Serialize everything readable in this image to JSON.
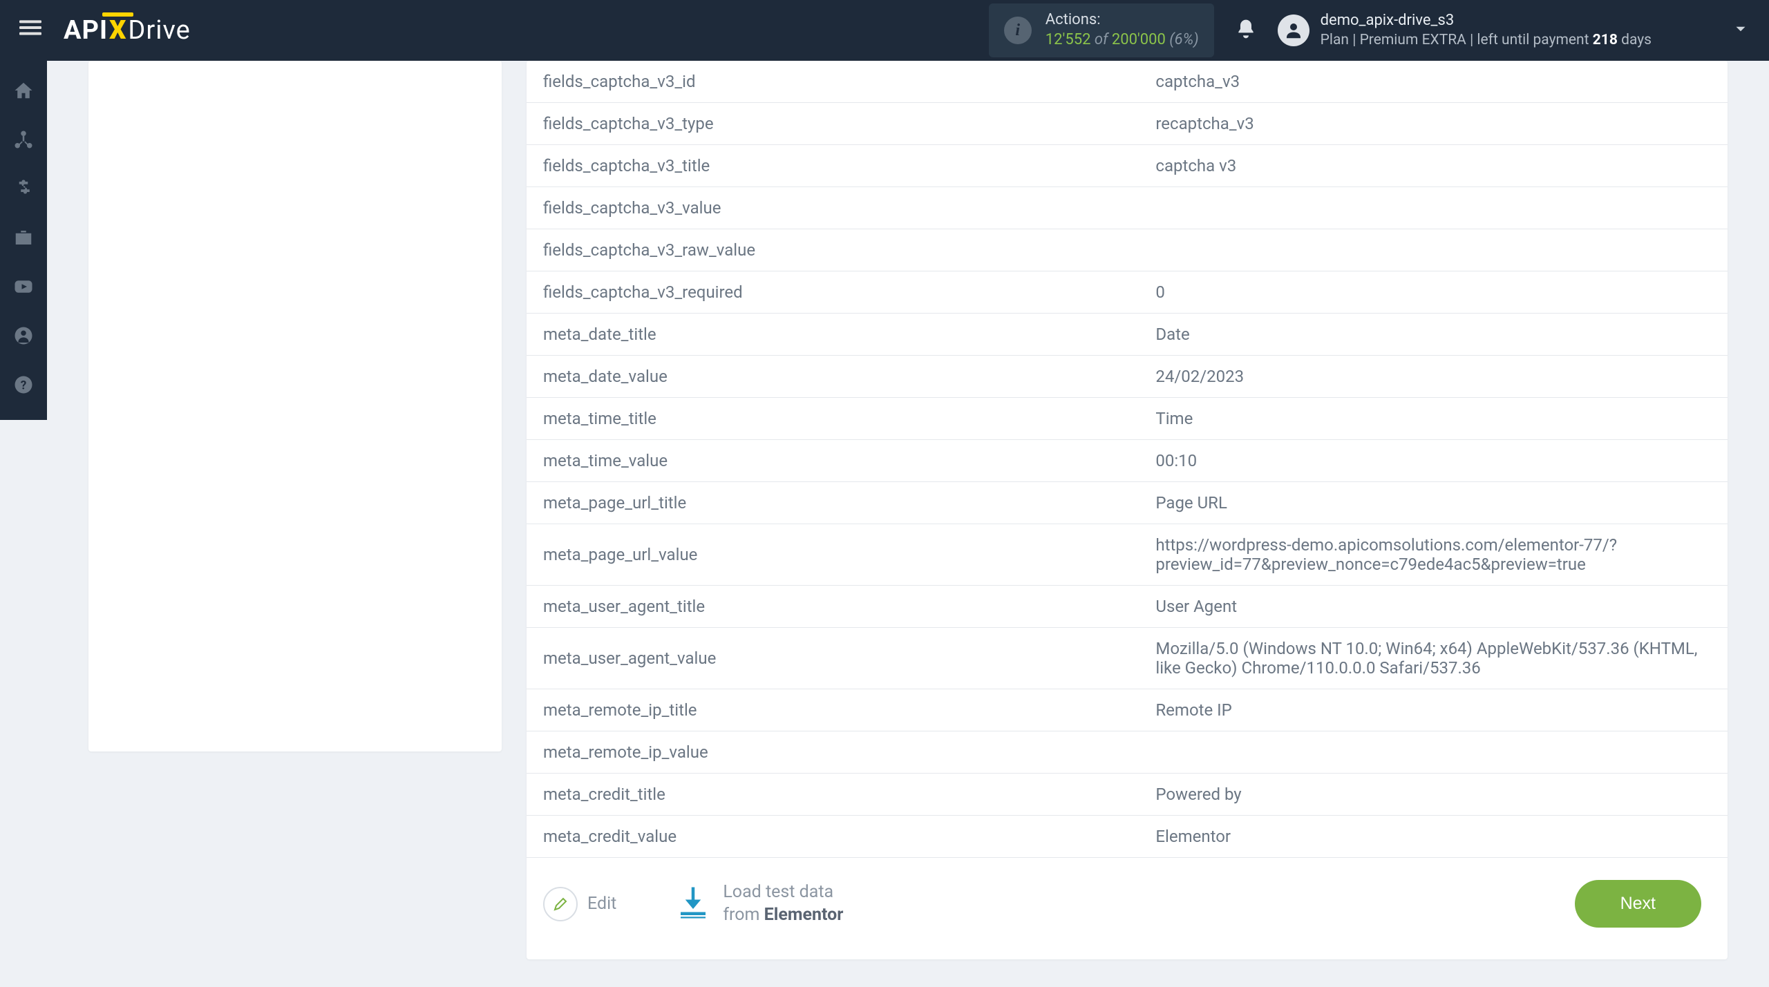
{
  "header": {
    "logo_api": "API",
    "logo_x": "X",
    "logo_drive": "Drive",
    "actions_label": "Actions:",
    "actions_used": "12'552",
    "actions_of": " of ",
    "actions_total": "200'000",
    "actions_pct": " (6%)",
    "user_name": "demo_apix-drive_s3",
    "plan_prefix": "Plan  | ",
    "plan_name": "Premium EXTRA",
    "plan_suffix": " |  left until payment ",
    "plan_days_num": "218",
    "plan_days_word": " days"
  },
  "rows": [
    {
      "key": "fields_captcha_v3_id",
      "val": "captcha_v3"
    },
    {
      "key": "fields_captcha_v3_type",
      "val": "recaptcha_v3"
    },
    {
      "key": "fields_captcha_v3_title",
      "val": "captcha v3"
    },
    {
      "key": "fields_captcha_v3_value",
      "val": ""
    },
    {
      "key": "fields_captcha_v3_raw_value",
      "val": ""
    },
    {
      "key": "fields_captcha_v3_required",
      "val": "0"
    },
    {
      "key": "meta_date_title",
      "val": "Date"
    },
    {
      "key": "meta_date_value",
      "val": "24/02/2023"
    },
    {
      "key": "meta_time_title",
      "val": "Time"
    },
    {
      "key": "meta_time_value",
      "val": "00:10"
    },
    {
      "key": "meta_page_url_title",
      "val": "Page URL"
    },
    {
      "key": "meta_page_url_value",
      "val": "https://wordpress-demo.apicomsolutions.com/elementor-77/?preview_id=77&preview_nonce=c79ede4ac5&preview=true"
    },
    {
      "key": "meta_user_agent_title",
      "val": "User Agent"
    },
    {
      "key": "meta_user_agent_value",
      "val": "Mozilla/5.0 (Windows NT 10.0; Win64; x64) AppleWebKit/537.36 (KHTML, like Gecko) Chrome/110.0.0.0 Safari/537.36"
    },
    {
      "key": "meta_remote_ip_title",
      "val": "Remote IP"
    },
    {
      "key": "meta_remote_ip_value",
      "val": " ",
      "blur": true
    },
    {
      "key": "meta_credit_title",
      "val": "Powered by"
    },
    {
      "key": "meta_credit_value",
      "val": "Elementor"
    }
  ],
  "footer": {
    "edit_label": "Edit",
    "load_line1": "Load test data",
    "load_from": "from ",
    "load_source": "Elementor",
    "next_label": "Next"
  }
}
